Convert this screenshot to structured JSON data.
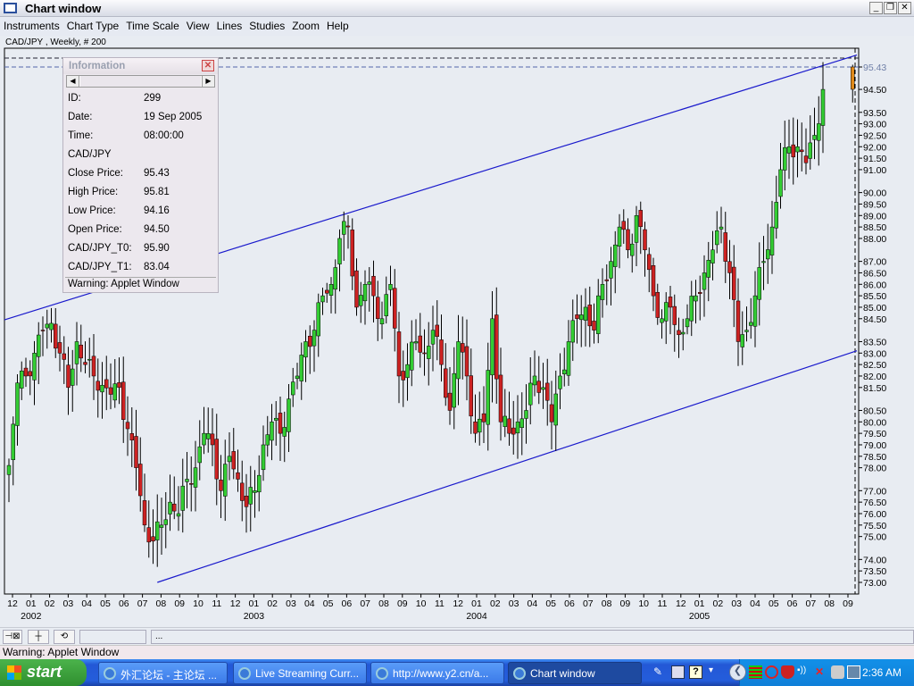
{
  "window": {
    "title": "Chart window"
  },
  "menu": [
    "Instruments",
    "Chart Type",
    "Time Scale",
    "View",
    "Lines",
    "Studies",
    "Zoom",
    "Help"
  ],
  "chart_header": "CAD/JPY , Weekly, # 200",
  "info_panel": {
    "title": "Information",
    "rows": [
      {
        "k": "ID:",
        "v": "299"
      },
      {
        "k": "Date:",
        "v": "19 Sep 2005"
      },
      {
        "k": "Time:",
        "v": "08:00:00"
      },
      {
        "k": "CAD/JPY",
        "v": ""
      },
      {
        "k": "Close Price:",
        "v": "95.43"
      },
      {
        "k": "High Price:",
        "v": "95.81"
      },
      {
        "k": "Low Price:",
        "v": "94.16"
      },
      {
        "k": "Open Price:",
        "v": "94.50"
      },
      {
        "k": "CAD/JPY_T0:",
        "v": "95.90"
      },
      {
        "k": "CAD/JPY_T1:",
        "v": "83.04"
      }
    ],
    "warning": "Warning: Applet Window"
  },
  "chart_data": {
    "type": "candlestick",
    "instrument": "CAD/JPY",
    "timeframe": "Weekly",
    "bars": 200,
    "y_ticks": [
      "95.43",
      "94.50",
      "93.50",
      "93.00",
      "92.50",
      "92.00",
      "91.50",
      "91.00",
      "90.00",
      "89.50",
      "89.00",
      "88.50",
      "88.00",
      "87.00",
      "86.50",
      "86.00",
      "85.50",
      "85.00",
      "84.50",
      "83.50",
      "83.00",
      "82.50",
      "82.00",
      "81.50",
      "80.50",
      "80.00",
      "79.50",
      "79.00",
      "78.50",
      "78.00",
      "77.00",
      "76.50",
      "76.00",
      "75.50",
      "75.00",
      "74.00",
      "73.50",
      "73.00"
    ],
    "ylim": [
      73,
      95.9
    ],
    "x_ticks": [
      "12",
      "01",
      "02",
      "03",
      "04",
      "05",
      "06",
      "07",
      "08",
      "09",
      "10",
      "11",
      "12",
      "01",
      "02",
      "03",
      "04",
      "05",
      "06",
      "07",
      "08",
      "09",
      "10",
      "11",
      "12",
      "01",
      "02",
      "03",
      "04",
      "05",
      "06",
      "07",
      "08",
      "09",
      "10",
      "11",
      "12",
      "01",
      "02",
      "03",
      "04",
      "05",
      "06",
      "07",
      "08",
      "09"
    ],
    "year_labels": [
      {
        "label": "2002",
        "tick": 1
      },
      {
        "label": "2003",
        "tick": 13
      },
      {
        "label": "2004",
        "tick": 25
      },
      {
        "label": "2005",
        "tick": 37
      }
    ],
    "approx_closes_biweekly": [
      78.1,
      81.7,
      82.0,
      83.0,
      84.0,
      84.3,
      83.0,
      81.5,
      83.5,
      82.5,
      82.0,
      81.6,
      81.2,
      81.5,
      79.7,
      78.0,
      75.5,
      74.8,
      75.5,
      76.5,
      76.0,
      77.5,
      78.0,
      79.5,
      79.0,
      77.0,
      78.5,
      77.5,
      76.3,
      77.0,
      79.0,
      80.0,
      79.5,
      81.0,
      82.0,
      83.5,
      84.0,
      85.5,
      86.0,
      88.0,
      88.5,
      85.0,
      86.0,
      85.5,
      84.5,
      86.0,
      82.0,
      82.5,
      83.5,
      83.0,
      84.0,
      82.5,
      80.5,
      83.5,
      82.0,
      79.5,
      80.0,
      84.5,
      80.0,
      79.5,
      80.0,
      80.5,
      82.0,
      81.5,
      80.0,
      82.0,
      83.5,
      84.5,
      85.0,
      84.0,
      86.0,
      87.0,
      88.5,
      87.5,
      89.0,
      87.5,
      85.5,
      84.5,
      85.0,
      83.8,
      84.5,
      85.5,
      86.5,
      87.5,
      88.5,
      86.5,
      83.5,
      84.0,
      85.5,
      87.0,
      88.5,
      91.0,
      92.0,
      92.0,
      91.3,
      92.5,
      94.5
    ],
    "last_bar": {
      "open": 94.5,
      "high": 95.81,
      "low": 94.16,
      "close": 95.43
    },
    "trendlines": [
      {
        "name": "upper channel",
        "start": {
          "bar": 0,
          "price": 84.45
        },
        "end": {
          "bar": 200,
          "price": 96.0
        }
      },
      {
        "name": "lower channel",
        "start": {
          "bar": 35,
          "price": 73.0
        },
        "end": {
          "bar": 200,
          "price": 83.1
        }
      }
    ],
    "hlines": [
      95.9,
      95.43
    ],
    "colors": {
      "up": "#33cc33",
      "down": "#cc2222",
      "last": "#e08a1a",
      "trend": "#1a1acc"
    }
  },
  "toolbar": {
    "field2": "..."
  },
  "status": "Warning: Applet Window",
  "taskbar": {
    "start": "start",
    "tasks": [
      "外汇论坛 - 主论坛 ...",
      "Live Streaming Curr...",
      "http://www.y2.cn/a...",
      "Chart window"
    ],
    "clock": "2:36 AM"
  }
}
